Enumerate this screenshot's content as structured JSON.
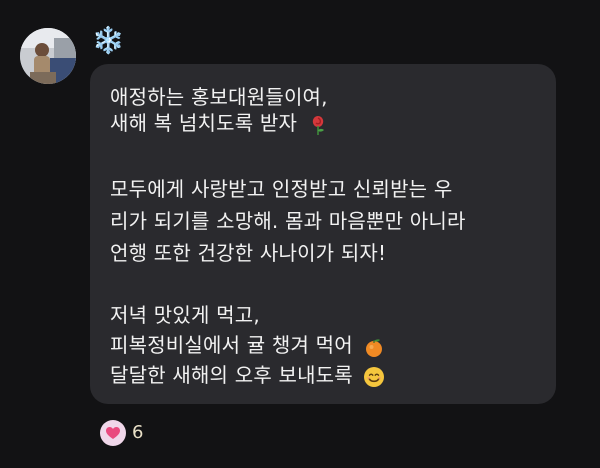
{
  "sender": {
    "name": "❄️",
    "avatar_icon": "profile-photo"
  },
  "message": {
    "lines": [
      "애정하는 홍보대원들이여,",
      "새해 복 넘치도록 받자",
      "모두에게 사랑받고 인정받고 신뢰받는 우",
      "리가 되기를 소망해. 몸과 마음뿐만 아니라",
      "언행 또한 건강한 사나이가 되자!",
      "저녁 맛있게 먹고,",
      "피복정비실에서 귤 챙겨 먹어",
      "달달한 새해의 오후 보내도록"
    ],
    "emoji": {
      "rose": "rose-icon",
      "tangerine": "tangerine-icon",
      "smile": "smiling-face-icon"
    }
  },
  "reaction": {
    "icon": "heart-icon",
    "count": "6"
  },
  "colors": {
    "background": "#121214",
    "bubble": "#2a2a2e",
    "text": "#f2f2f2",
    "heart_badge": "#f0d7ea",
    "heart": "#e94a7f"
  }
}
